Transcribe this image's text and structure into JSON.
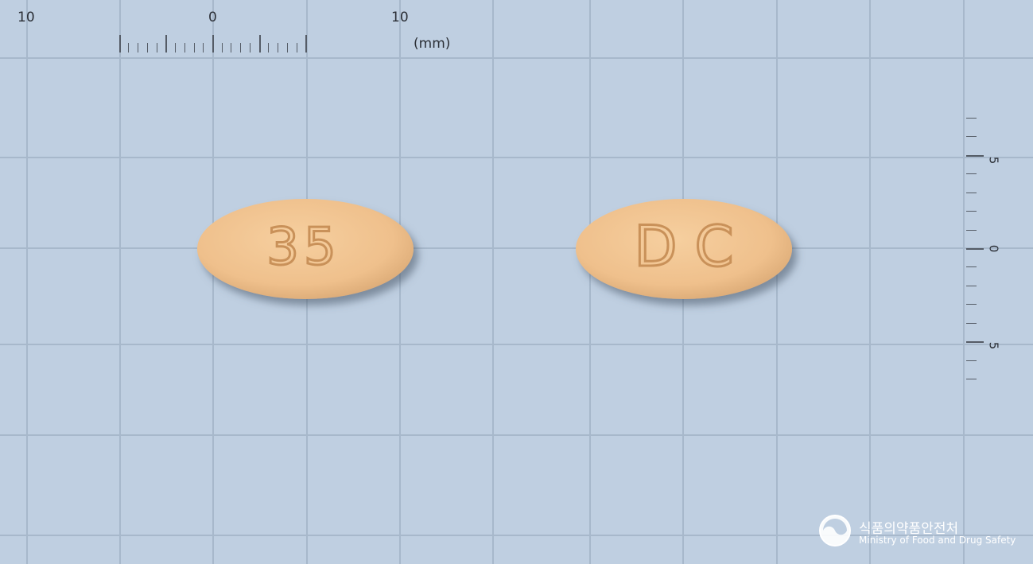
{
  "ruler": {
    "top_labels": [
      "10",
      "0",
      "10"
    ],
    "unit": "(mm)",
    "side_labels": [
      "5",
      "0",
      "5"
    ]
  },
  "tablets": [
    {
      "imprint": "35",
      "color": "#f1c48f"
    },
    {
      "imprint": "D C",
      "color": "#f1c48f"
    }
  ],
  "background_color": "#bfcfe1",
  "watermark": {
    "org_korean": "식품의약품안전처",
    "org_english": "Ministry of Food and Drug Safety"
  }
}
